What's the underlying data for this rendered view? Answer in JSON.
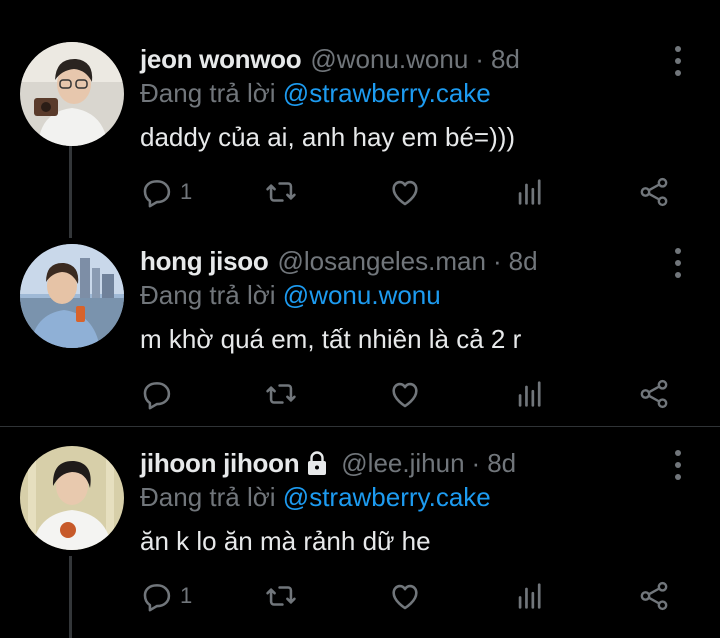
{
  "tweets": [
    {
      "name": "jeon wonwoo",
      "handle": "@wonu.wonu",
      "separator": "·",
      "time": "8d",
      "replying_prefix": "Đang trả lời",
      "replying_to": "@strawberry.cake",
      "text": "daddy của ai, anh hay em bé=)))",
      "reply_count": "1",
      "locked": false,
      "avatar_icon": "avatar-photo"
    },
    {
      "name": "hong jisoo",
      "handle": "@losangeles.man",
      "separator": "·",
      "time": "8d",
      "replying_prefix": "Đang trả lời",
      "replying_to": "@wonu.wonu",
      "text": "m khờ quá em, tất nhiên là cả 2 r",
      "reply_count": "",
      "locked": false,
      "avatar_icon": "avatar-photo"
    },
    {
      "name": "jihoon jihoon",
      "handle": "@lee.jihun",
      "separator": "·",
      "time": "8d",
      "replying_prefix": "Đang trả lời",
      "replying_to": "@strawberry.cake",
      "text": "ăn k lo ăn mà rảnh dữ he",
      "reply_count": "1",
      "locked": true,
      "avatar_icon": "avatar-photo"
    }
  ],
  "icons": [
    "reply-icon",
    "retweet-icon",
    "like-icon",
    "analytics-icon",
    "share-icon",
    "more-icon",
    "lock-icon"
  ],
  "colors": {
    "background": "#000000",
    "text": "#e7e9ea",
    "muted": "#71767b",
    "link": "#1d9bf0",
    "divider": "#2f3336"
  }
}
